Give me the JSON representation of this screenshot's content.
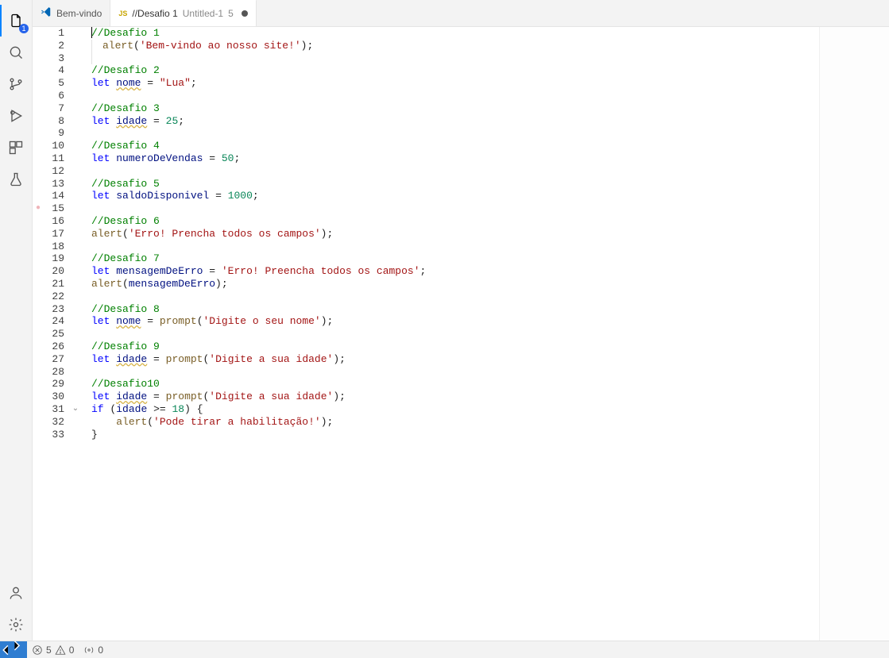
{
  "activity_bar": {
    "explorer_badge": "1"
  },
  "tabs": [
    {
      "label": "Bem-vindo",
      "kind": "welcome",
      "active": false,
      "dirty": false
    },
    {
      "label": "//Desafio 1",
      "suffix": "Untitled-1",
      "number": "5",
      "kind": "js",
      "active": true,
      "dirty": true
    }
  ],
  "editor": {
    "lines": [
      {
        "n": "1",
        "tokens": [
          [
            "caret",
            ""
          ],
          [
            "comment",
            "//Desafio 1"
          ]
        ]
      },
      {
        "n": "2",
        "tokens": [
          [
            "func",
            "alert"
          ],
          [
            "punc",
            "("
          ],
          [
            "string",
            "'Bem-vindo ao nosso site!'"
          ],
          [
            "punc",
            ")"
          ],
          [
            "punc",
            ";"
          ]
        ],
        "guide": true
      },
      {
        "n": "3",
        "tokens": [],
        "guide": true
      },
      {
        "n": "4",
        "tokens": [
          [
            "comment",
            "//Desafio 2"
          ]
        ]
      },
      {
        "n": "5",
        "tokens": [
          [
            "let",
            "let"
          ],
          [
            "text",
            " "
          ],
          [
            "varwarn",
            "nome"
          ],
          [
            "text",
            " "
          ],
          [
            "punc",
            "="
          ],
          [
            "text",
            " "
          ],
          [
            "string",
            "\"Lua\""
          ],
          [
            "punc",
            ";"
          ]
        ]
      },
      {
        "n": "6",
        "tokens": []
      },
      {
        "n": "7",
        "tokens": [
          [
            "comment",
            "//Desafio 3"
          ]
        ]
      },
      {
        "n": "8",
        "tokens": [
          [
            "let",
            "let"
          ],
          [
            "text",
            " "
          ],
          [
            "varwarn",
            "idade"
          ],
          [
            "text",
            " "
          ],
          [
            "punc",
            "="
          ],
          [
            "text",
            " "
          ],
          [
            "number",
            "25"
          ],
          [
            "punc",
            ";"
          ]
        ]
      },
      {
        "n": "9",
        "tokens": []
      },
      {
        "n": "10",
        "tokens": [
          [
            "comment",
            "//Desafio 4"
          ]
        ]
      },
      {
        "n": "11",
        "tokens": [
          [
            "let",
            "let"
          ],
          [
            "text",
            " "
          ],
          [
            "var",
            "numeroDeVendas"
          ],
          [
            "text",
            " "
          ],
          [
            "punc",
            "="
          ],
          [
            "text",
            " "
          ],
          [
            "number",
            "50"
          ],
          [
            "punc",
            ";"
          ]
        ]
      },
      {
        "n": "12",
        "tokens": []
      },
      {
        "n": "13",
        "tokens": [
          [
            "comment",
            "//Desafio 5"
          ]
        ]
      },
      {
        "n": "14",
        "tokens": [
          [
            "let",
            "let"
          ],
          [
            "text",
            " "
          ],
          [
            "var",
            "saldoDisponivel"
          ],
          [
            "text",
            " "
          ],
          [
            "punc",
            "="
          ],
          [
            "text",
            " "
          ],
          [
            "number",
            "1000"
          ],
          [
            "punc",
            ";"
          ]
        ]
      },
      {
        "n": "15",
        "tokens": [],
        "breakpoint": true
      },
      {
        "n": "16",
        "tokens": [
          [
            "comment",
            "//Desafio 6"
          ]
        ]
      },
      {
        "n": "17",
        "tokens": [
          [
            "func",
            "alert"
          ],
          [
            "punc",
            "("
          ],
          [
            "string",
            "'Erro! Prencha todos os campos'"
          ],
          [
            "punc",
            ")"
          ],
          [
            "punc",
            ";"
          ]
        ]
      },
      {
        "n": "18",
        "tokens": []
      },
      {
        "n": "19",
        "tokens": [
          [
            "comment",
            "//Desafio 7"
          ]
        ]
      },
      {
        "n": "20",
        "tokens": [
          [
            "let",
            "let"
          ],
          [
            "text",
            " "
          ],
          [
            "var",
            "mensagemDeErro"
          ],
          [
            "text",
            " "
          ],
          [
            "punc",
            "="
          ],
          [
            "text",
            " "
          ],
          [
            "string",
            "'Erro! Preencha todos os campos'"
          ],
          [
            "punc",
            ";"
          ]
        ]
      },
      {
        "n": "21",
        "tokens": [
          [
            "func",
            "alert"
          ],
          [
            "punc",
            "("
          ],
          [
            "var",
            "mensagemDeErro"
          ],
          [
            "punc",
            ")"
          ],
          [
            "punc",
            ";"
          ]
        ]
      },
      {
        "n": "22",
        "tokens": []
      },
      {
        "n": "23",
        "tokens": [
          [
            "comment",
            "//Desafio 8"
          ]
        ]
      },
      {
        "n": "24",
        "tokens": [
          [
            "let",
            "let"
          ],
          [
            "text",
            " "
          ],
          [
            "varwarn",
            "nome"
          ],
          [
            "text",
            " "
          ],
          [
            "punc",
            "="
          ],
          [
            "text",
            " "
          ],
          [
            "func",
            "prompt"
          ],
          [
            "punc",
            "("
          ],
          [
            "string",
            "'Digite o seu nome'"
          ],
          [
            "punc",
            ")"
          ],
          [
            "punc",
            ";"
          ]
        ]
      },
      {
        "n": "25",
        "tokens": []
      },
      {
        "n": "26",
        "tokens": [
          [
            "comment",
            "//Desafio 9"
          ]
        ]
      },
      {
        "n": "27",
        "tokens": [
          [
            "let",
            "let"
          ],
          [
            "text",
            " "
          ],
          [
            "varwarn",
            "idade"
          ],
          [
            "text",
            " "
          ],
          [
            "punc",
            "="
          ],
          [
            "text",
            " "
          ],
          [
            "func",
            "prompt"
          ],
          [
            "punc",
            "("
          ],
          [
            "string",
            "'Digite a sua idade'"
          ],
          [
            "punc",
            ")"
          ],
          [
            "punc",
            ";"
          ]
        ]
      },
      {
        "n": "28",
        "tokens": []
      },
      {
        "n": "29",
        "tokens": [
          [
            "comment",
            "//Desafio10"
          ]
        ]
      },
      {
        "n": "30",
        "tokens": [
          [
            "let",
            "let"
          ],
          [
            "text",
            " "
          ],
          [
            "varwarn",
            "idade"
          ],
          [
            "text",
            " "
          ],
          [
            "punc",
            "="
          ],
          [
            "text",
            " "
          ],
          [
            "func",
            "prompt"
          ],
          [
            "punc",
            "("
          ],
          [
            "string",
            "'Digite a sua idade'"
          ],
          [
            "punc",
            ")"
          ],
          [
            "punc",
            ";"
          ]
        ]
      },
      {
        "n": "31",
        "tokens": [
          [
            "keyword",
            "if"
          ],
          [
            "text",
            " "
          ],
          [
            "punc",
            "("
          ],
          [
            "var",
            "idade"
          ],
          [
            "text",
            " "
          ],
          [
            "punc",
            ">="
          ],
          [
            "text",
            " "
          ],
          [
            "number",
            "18"
          ],
          [
            "punc",
            ")"
          ],
          [
            "text",
            " "
          ],
          [
            "punc",
            "{"
          ]
        ],
        "fold": true
      },
      {
        "n": "32",
        "tokens": [
          [
            "text",
            "    "
          ],
          [
            "func",
            "alert"
          ],
          [
            "punc",
            "("
          ],
          [
            "string",
            "'Pode tirar a habilitação!'"
          ],
          [
            "punc",
            ")"
          ],
          [
            "punc",
            ";"
          ]
        ]
      },
      {
        "n": "33",
        "tokens": [
          [
            "punc",
            "}"
          ]
        ]
      }
    ]
  },
  "status_bar": {
    "errors": "5",
    "warnings": "0",
    "ports": "0"
  }
}
